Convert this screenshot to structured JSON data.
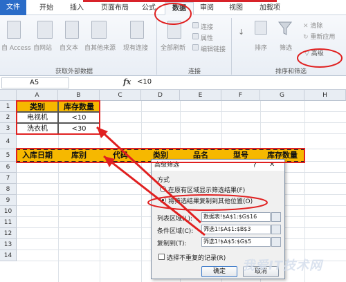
{
  "tabs": {
    "file": "文件",
    "home": "开始",
    "insert": "插入",
    "page_layout": "页面布局",
    "formulas": "公式",
    "data": "数据",
    "review": "审阅",
    "view": "视图",
    "addins": "加载项"
  },
  "ribbon": {
    "from_access": "自 Access",
    "from_web": "自网站",
    "from_text": "自文本",
    "from_other": "自其他来源",
    "existing_conn": "现有连接",
    "refresh_all": "全部刷新",
    "connections": "连接",
    "properties": "属性",
    "edit_links": "编辑链接",
    "sort": "排序",
    "filter": "筛选",
    "clear": "清除",
    "reapply": "重新应用",
    "advanced": "高级",
    "group_external": "获取外部数据",
    "group_connections": "连接",
    "group_sort_filter": "排序和筛选"
  },
  "formula_bar": {
    "name_box": "A5",
    "fx": "fx",
    "value": "<10"
  },
  "grid": {
    "columns": [
      "A",
      "B",
      "C",
      "D",
      "E",
      "F",
      "G",
      "H"
    ],
    "rows": [
      "1",
      "2",
      "3",
      "4",
      "5",
      "6",
      "7",
      "8",
      "9",
      "10",
      "11",
      "12",
      "13",
      "14"
    ],
    "criteria": {
      "a1": "类别",
      "b1": "库存数量",
      "a2": "电视机",
      "b2": "<10",
      "a3": "洗衣机",
      "b3": "<30"
    },
    "headers": [
      "入库日期",
      "库别",
      "代码",
      "类别",
      "品名",
      "型号",
      "库存数量"
    ]
  },
  "dialog": {
    "title": "高级筛选",
    "help": "?",
    "close": "✕",
    "method_label": "方式",
    "option_inplace": "在原有区域显示筛选结果(F)",
    "option_copy": "将筛选结果复制到其他位置(O)",
    "list_range_label": "列表区域(L):",
    "list_range_value": "数据表!$A$1:$G$16",
    "criteria_range_label": "条件区域(C):",
    "criteria_range_value": "筛选1!$A$1:$B$3",
    "copy_to_label": "复制到(T):",
    "copy_to_value": "筛选1!$A$5:$G$5",
    "unique_label": "选择不重复的记录(R)",
    "ok": "确定",
    "cancel": "取消"
  },
  "watermark": "我爱IT技术网",
  "colors": {
    "header_fill": "#f6b800",
    "annotation_red": "#e02020",
    "file_tab": "#2a6cc8"
  }
}
